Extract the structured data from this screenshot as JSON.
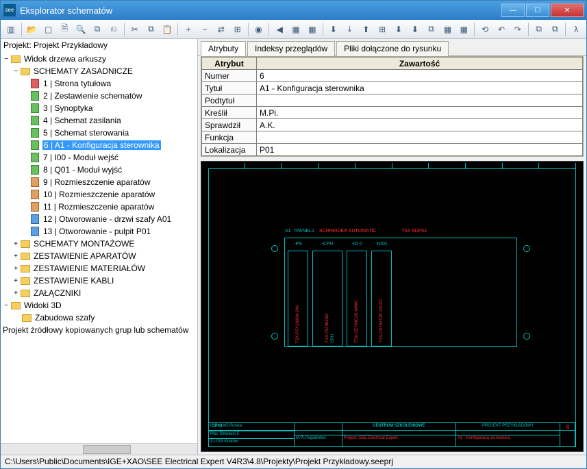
{
  "window": {
    "title": "Eksplorator schematów"
  },
  "project_label": "Projekt: Projekt Przykładowy",
  "tree": {
    "root1": "Widok drzewa arkuszy",
    "folder_main": "SCHEMATY ZASADNICZE",
    "sheets": [
      "1 | Strona tytułowa",
      "2 | Zestawienie schematów",
      "3 | Synoptyka",
      "4 | Schemat zasilania",
      "5 | Schemat sterowania",
      "6 | A1 - Konfiguracja sterownika",
      "7 | I00 - Moduł wejść",
      "8 | Q01 - Moduł wyjść",
      "9 | Rozmieszczenie aparatów",
      "10 | Rozmieszczenie aparatów",
      "11 | Rozmieszczenie aparatów",
      "12 | Otworowanie - drzwi szafy A01",
      "13 | Otworowanie - pulpit P01"
    ],
    "folders2": [
      "SCHEMATY MONTAŻOWE",
      "ZESTAWIENIE APARATÓW",
      "ZESTAWIENIE MATERIAŁÓW",
      "ZESTAWIENIE KABLI",
      "ZAŁĄCZNIKI"
    ],
    "root2": "Widoki 3D",
    "sub3d": "Zabudowa szafy",
    "root3": "Projekt źródłowy kopiowanych grup lub schematów"
  },
  "tabs": {
    "t1": "Atrybuty",
    "t2": "Indeksy przeglądów",
    "t3": "Pliki dołączone do rysunku"
  },
  "attr": {
    "h1": "Atrybut",
    "h2": "Zawartość",
    "rows": [
      {
        "k": "Numer",
        "v": "6"
      },
      {
        "k": "Tytuł",
        "v": "A1 - Konfiguracja sterownika"
      },
      {
        "k": "Podtytuł",
        "v": ""
      },
      {
        "k": "Kreślił",
        "v": "M.Pi."
      },
      {
        "k": "Sprawdził",
        "v": "A.K."
      },
      {
        "k": "Funkcja",
        "v": ""
      },
      {
        "k": "Lokalizacja",
        "v": "P01"
      }
    ]
  },
  "preview": {
    "a1": "A1",
    "panel": "=PANEL1",
    "txt1": "SCHNEIDER AUTOMATIC",
    "txt2": "TSX MJF53",
    "slots": [
      "-PS",
      "-CPU",
      "-IO 0",
      "-IO01"
    ],
    "vlabels": [
      "TSX-PSY2600M 24V",
      "TSX-P573623M",
      "CPU",
      "TSX-DEY64D2K 64WC",
      "TSX-DSY64T2K 24VDC"
    ],
    "p01": "=P01",
    "tb_left1": "IGE+XAO Polska",
    "tb_left2": "Plac Słowacki 5",
    "tb_left3": "31-019 Kraków",
    "tb_mid": "M.Pi.Pogalimber",
    "tb_center": "CENTRUM SZKOLENIOWE",
    "tb_center2": "Project:    SEE Electrical Expert",
    "tb_right1": "PROJEKT PRZYKŁADOWY",
    "tb_right2": "A1 - Konfiguracja sterownika",
    "tb_num": "6"
  },
  "status": "C:\\Users\\Public\\Documents\\IGE+XAO\\SEE Electrical Expert V4R3\\4.8\\Projekty\\Projekt Przykładowy.seeprj"
}
